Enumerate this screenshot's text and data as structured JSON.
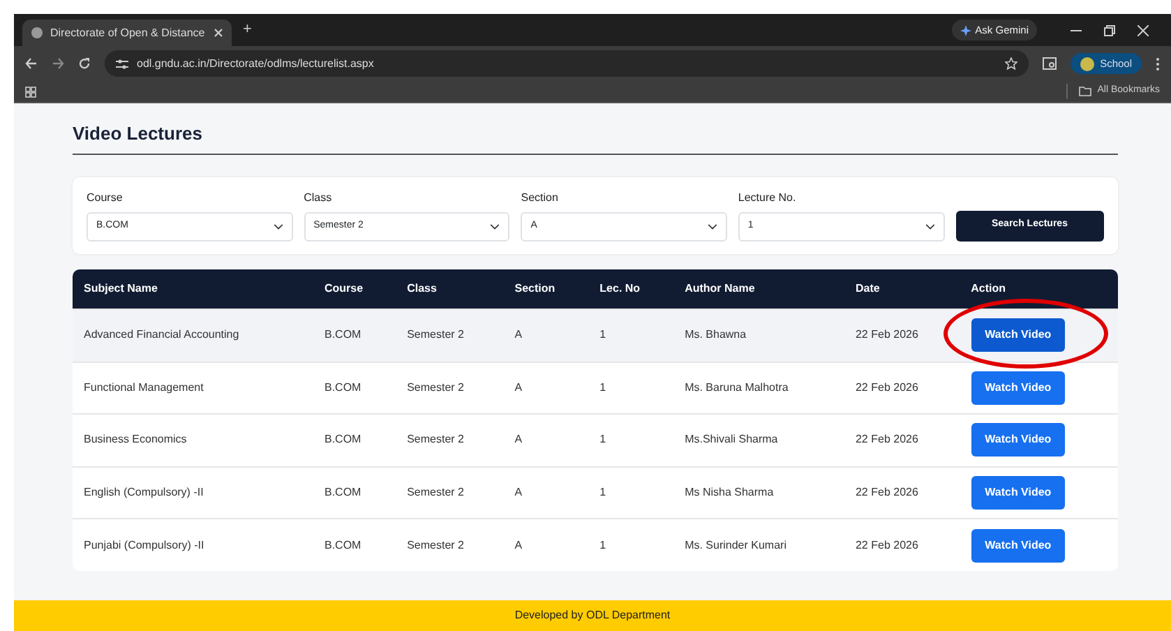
{
  "browser": {
    "tab_title": "Directorate of Open & Distance",
    "new_tab": "+",
    "url": "odl.gndu.ac.in/Directorate/odlms/lecturelist.aspx",
    "gemini": "Ask Gemini",
    "profile": "School",
    "bookmarks": "All Bookmarks"
  },
  "page": {
    "heading": "Video Lectures",
    "filters": [
      {
        "label": "Course",
        "value": "B.COM"
      },
      {
        "label": "Class",
        "value": "Semester 2"
      },
      {
        "label": "Section",
        "value": "A"
      },
      {
        "label": "Lecture No.",
        "value": "1"
      }
    ],
    "search_button": "Search Lectures",
    "table": {
      "columns": [
        "Subject Name",
        "Course",
        "Class",
        "Section",
        "Lec. No",
        "Author Name",
        "Date",
        "Action"
      ],
      "rows": [
        {
          "cells": [
            "Advanced Financial Accounting",
            "B.COM",
            "Semester 2",
            "A",
            "1",
            "Ms. Bhawna",
            "22 Feb 2026"
          ],
          "action": "Watch Video",
          "highlighted": true,
          "circled": true
        },
        {
          "cells": [
            "Functional Management",
            "B.COM",
            "Semester 2",
            "A",
            "1",
            "Ms. Baruna Malhotra",
            "22 Feb 2026"
          ],
          "action": "Watch Video",
          "highlighted": false,
          "circled": false
        },
        {
          "cells": [
            "Business Economics",
            "B.COM",
            "Semester 2",
            "A",
            "1",
            "Ms.Shivali Sharma",
            "22 Feb 2026"
          ],
          "action": "Watch Video",
          "highlighted": false,
          "circled": false
        },
        {
          "cells": [
            "English (Compulsory) -II",
            "B.COM",
            "Semester 2",
            "A",
            "1",
            "Ms Nisha Sharma",
            "22 Feb 2026"
          ],
          "action": "Watch Video",
          "highlighted": false,
          "circled": false
        },
        {
          "cells": [
            "Punjabi (Compulsory) -II",
            "B.COM",
            "Semester 2",
            "A",
            "1",
            "Ms. Surinder Kumari",
            "22 Feb 2026"
          ],
          "action": "Watch Video",
          "highlighted": false,
          "circled": false
        }
      ]
    },
    "footer": "Developed by ODL Department"
  }
}
